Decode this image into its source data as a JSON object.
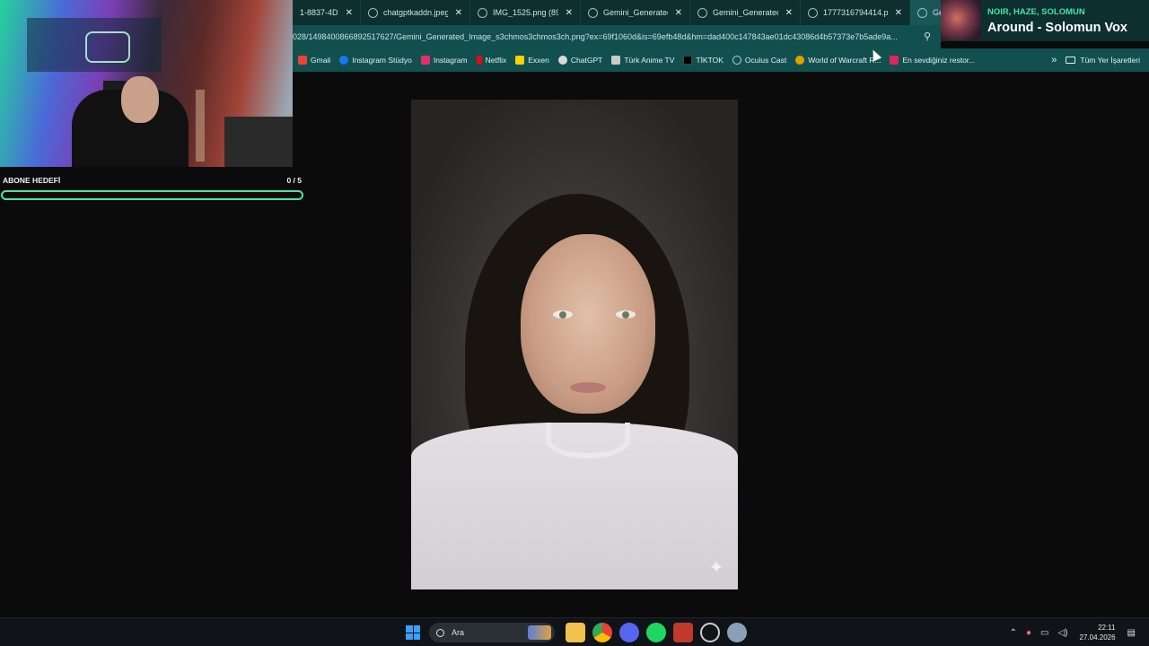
{
  "tabs": [
    {
      "title": "1-8837-4D8",
      "active": false
    },
    {
      "title": "chatgptkaddn.jpeg (8",
      "active": false
    },
    {
      "title": "IMG_1525.png (896",
      "active": false
    },
    {
      "title": "Gemini_Generated_Im",
      "active": false
    },
    {
      "title": "Gemini_Generated_Im",
      "active": false
    },
    {
      "title": "1777316794414.png",
      "active": false
    },
    {
      "title": "Gem",
      "active": true
    }
  ],
  "address": {
    "url": "028/1498400866892517627/Gemini_Generated_Image_s3chmos3chmos3ch.png?ex=69f1060d&is=69efb48d&hm=dad400c147843ae01dc43086d4b57373e7b5ade9a..."
  },
  "bookmarks": [
    {
      "label": "Gmail",
      "icon": "gmail-icon",
      "color": "#ea4335"
    },
    {
      "label": "Instagram Stüdyo",
      "icon": "meta-icon",
      "color": "#1877f2"
    },
    {
      "label": "Instagram",
      "icon": "instagram-icon",
      "color": "#e1306c"
    },
    {
      "label": "Netflix",
      "icon": "netflix-icon",
      "color": "#e50914"
    },
    {
      "label": "Exxen",
      "icon": "exxen-icon",
      "color": "#f5d300"
    },
    {
      "label": "ChatGPT",
      "icon": "chatgpt-icon",
      "color": "#d9d9d9"
    },
    {
      "label": "Türk Anime TV",
      "icon": "anime-icon",
      "color": "#cccccc"
    },
    {
      "label": "TİKTOK",
      "icon": "tiktok-icon",
      "color": "#000000"
    },
    {
      "label": "Oculus Cast",
      "icon": "globe-icon",
      "color": "#12504f"
    },
    {
      "label": "World of Warcraft R...",
      "icon": "wow-icon",
      "color": "#e0a000"
    },
    {
      "label": "En sevdiğiniz restor...",
      "icon": "yemek-icon",
      "color": "#e2245b"
    }
  ],
  "bookmarks_all": "Tüm Yer İşaretleri",
  "stream": {
    "goal_label": "ABONE HEDEFİ",
    "goal_count": "0 / 5",
    "goal_progress": 0
  },
  "now_playing": {
    "artist": "NOIR, HAZE, SOLOMUN",
    "title": "Around - Solomun Vox"
  },
  "taskbar": {
    "search_placeholder": "Ara",
    "time": "22:11",
    "date": "27.04.2026"
  },
  "colors": {
    "accent": "#4be3a3",
    "browser_bg": "#12504f",
    "tab_bg": "#0d2f30"
  }
}
